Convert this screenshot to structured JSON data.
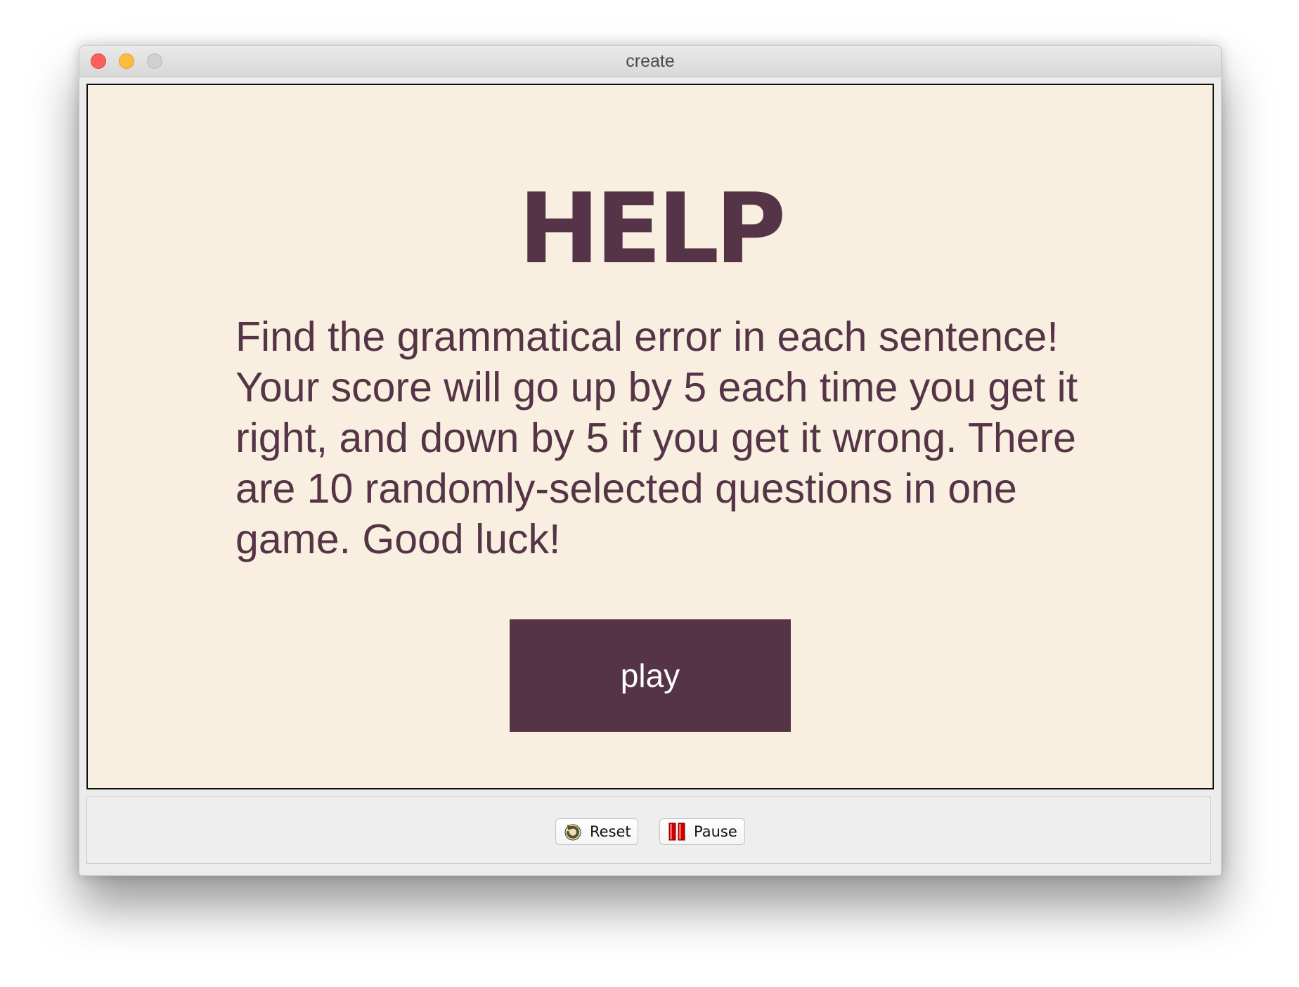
{
  "window": {
    "title": "create"
  },
  "help": {
    "title": "HELP",
    "body": "Find the grammatical error in each sentence! Your score will go up by 5 each time you get it right, and down by 5 if you get it wrong. There are 10 randomly-selected questions in one game. Good luck!",
    "play_label": "play"
  },
  "controls": {
    "reset_label": "Reset",
    "reset_icon": "reset-icon",
    "pause_label": "Pause",
    "pause_icon": "pause-icon"
  },
  "colors": {
    "accent": "#563447",
    "background": "#f9efe0"
  }
}
